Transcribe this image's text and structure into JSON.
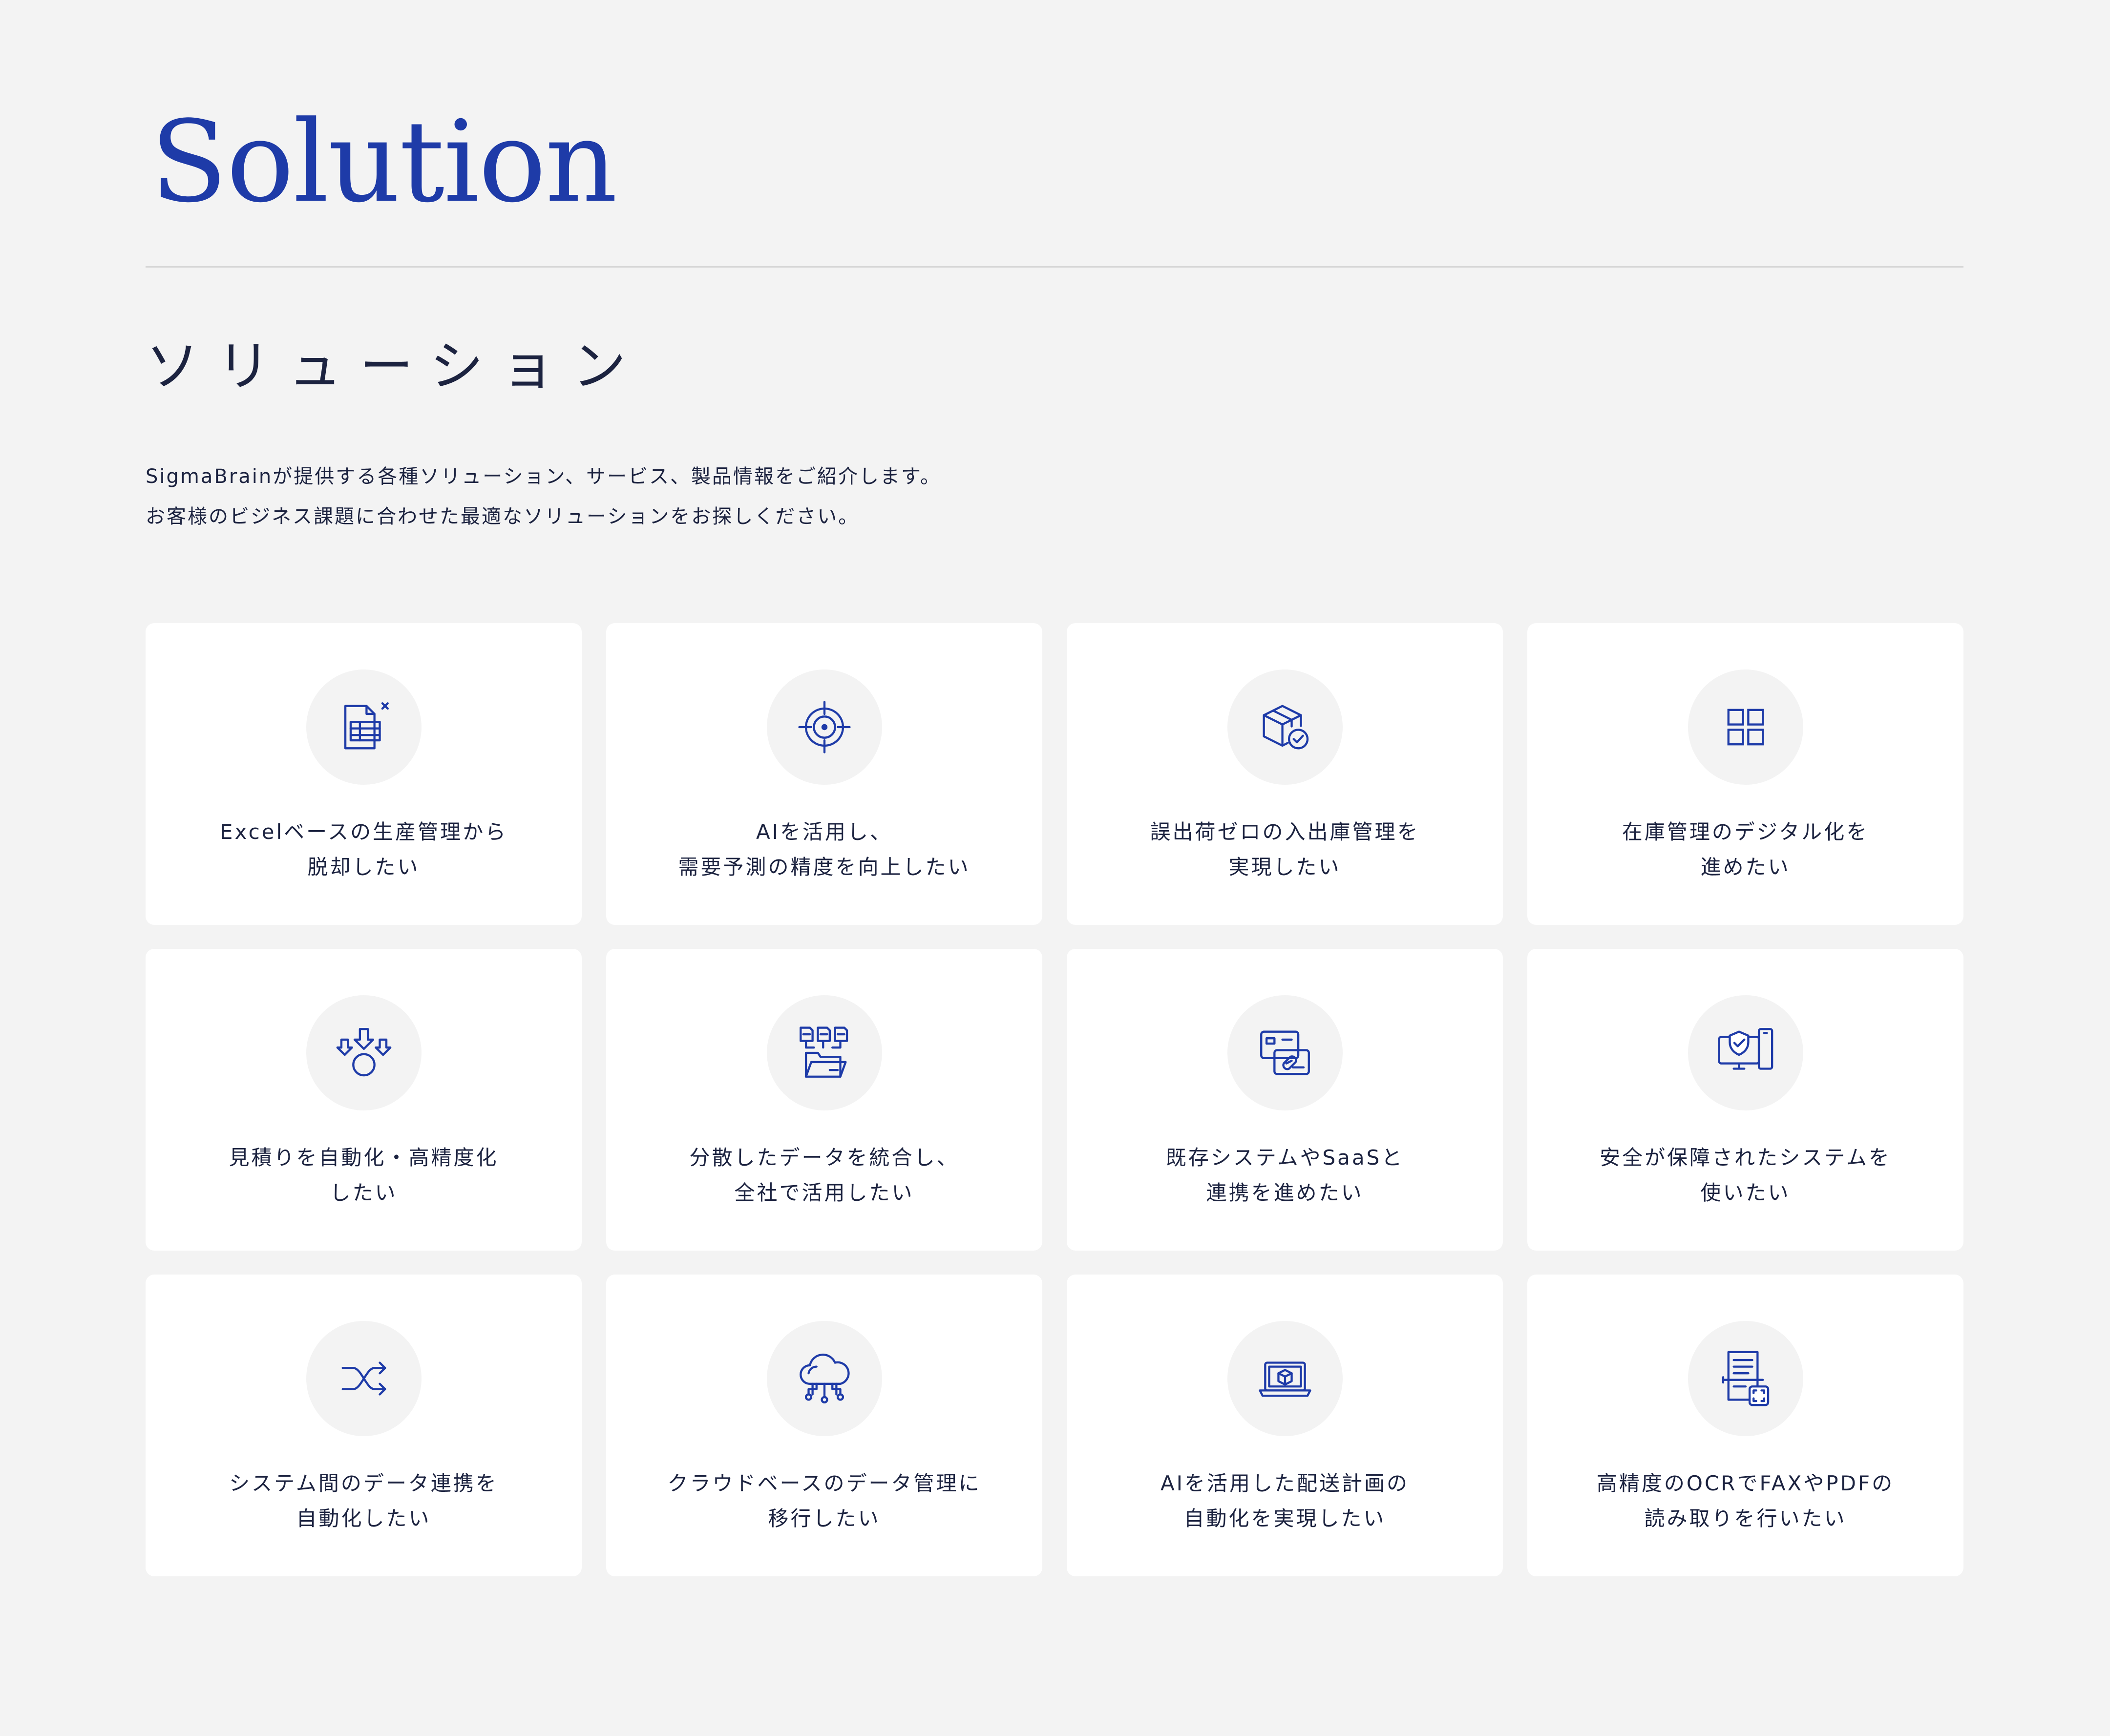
{
  "header": {
    "title_en": "Solution",
    "title_jp": "ソリューション",
    "description": [
      "SigmaBrainが提供する各種ソリューション、サービス、製品情報をご紹介します。",
      "お客様のビジネス課題に合わせた最適なソリューションをお探しください。"
    ]
  },
  "colors": {
    "accent": "#1e3ba8",
    "text": "#1c2340",
    "background": "#f3f3f3",
    "card": "#ffffff"
  },
  "cards": [
    {
      "icon": "excel-sheet-icon",
      "lines": [
        "Excelベースの生産管理から",
        "脱却したい"
      ]
    },
    {
      "icon": "target-icon",
      "lines": [
        "AIを活用し、",
        "需要予測の精度を向上したい"
      ]
    },
    {
      "icon": "box-check-icon",
      "lines": [
        "誤出荷ゼロの入出庫管理を",
        "実現したい"
      ]
    },
    {
      "icon": "grid-icon",
      "lines": [
        "在庫管理のデジタル化を",
        "進めたい"
      ]
    },
    {
      "icon": "arrows-merge-icon",
      "lines": [
        "見積りを自動化・高精度化",
        "したい"
      ]
    },
    {
      "icon": "files-folder-icon",
      "lines": [
        "分散したデータを統合し、",
        "全社で活用したい"
      ]
    },
    {
      "icon": "link-cards-icon",
      "lines": [
        "既存システムやSaaSと",
        "連携を進めたい"
      ]
    },
    {
      "icon": "secure-devices-icon",
      "lines": [
        "安全が保障されたシステムを",
        "使いたい"
      ]
    },
    {
      "icon": "shuffle-icon",
      "lines": [
        "システム間のデータ連携を",
        "自動化したい"
      ]
    },
    {
      "icon": "cloud-network-icon",
      "lines": [
        "クラウドベースのデータ管理に",
        "移行したい"
      ]
    },
    {
      "icon": "laptop-box-icon",
      "lines": [
        "AIを活用した配送計画の",
        "自動化を実現したい"
      ]
    },
    {
      "icon": "document-scan-icon",
      "lines": [
        "高精度のOCRでFAXやPDFの",
        "読み取りを行いたい"
      ]
    }
  ]
}
